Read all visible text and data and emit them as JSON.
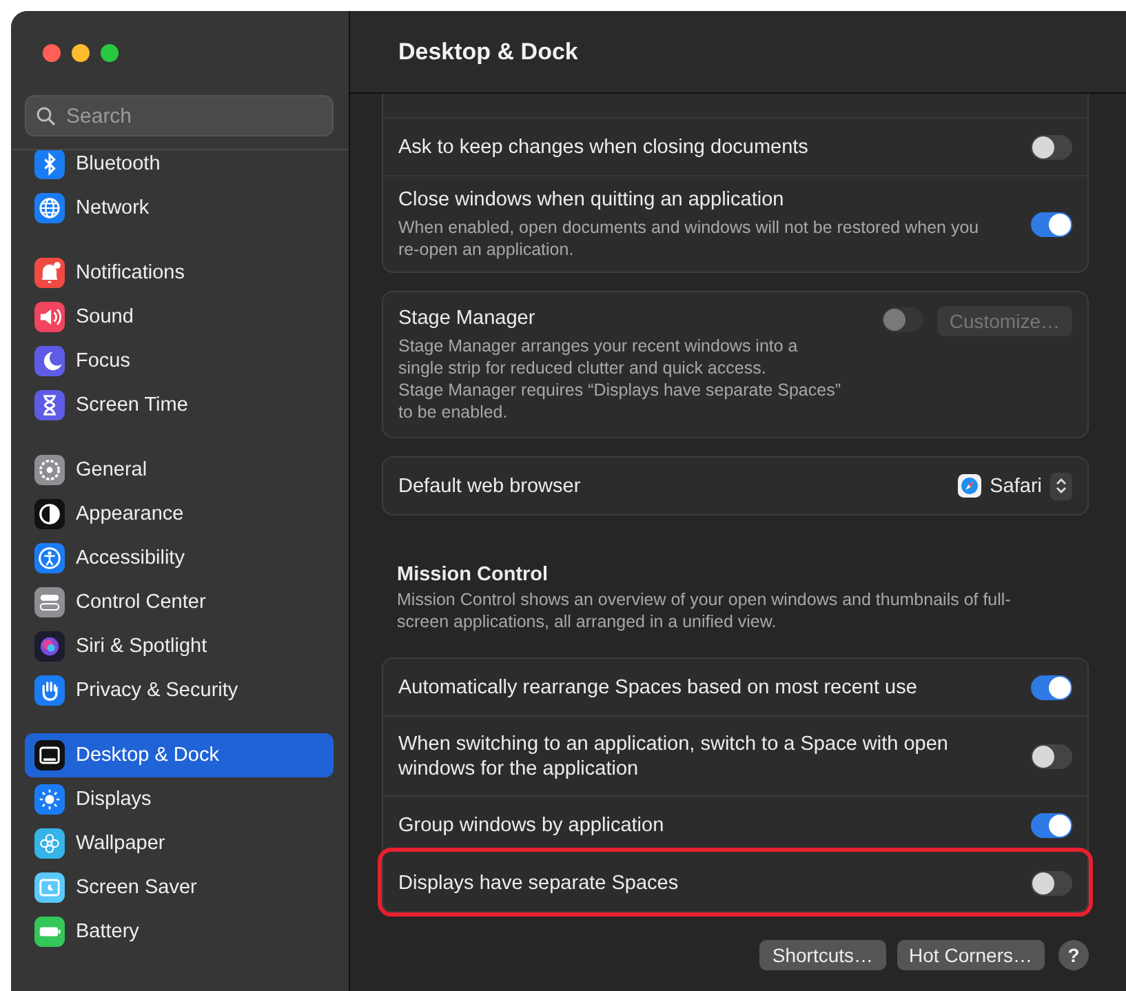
{
  "window": {
    "title": "Desktop & Dock"
  },
  "sidebar": {
    "search": {
      "placeholder": "Search"
    },
    "groups": [
      [
        {
          "label": "Bluetooth",
          "selected": false
        },
        {
          "label": "Network",
          "selected": false
        }
      ],
      [
        {
          "label": "Notifications",
          "selected": false
        },
        {
          "label": "Sound",
          "selected": false
        },
        {
          "label": "Focus",
          "selected": false
        },
        {
          "label": "Screen Time",
          "selected": false
        }
      ],
      [
        {
          "label": "General",
          "selected": false
        },
        {
          "label": "Appearance",
          "selected": false
        },
        {
          "label": "Accessibility",
          "selected": false
        },
        {
          "label": "Control Center",
          "selected": false
        },
        {
          "label": "Siri & Spotlight",
          "selected": false
        },
        {
          "label": "Privacy & Security",
          "selected": false
        }
      ],
      [
        {
          "label": "Desktop & Dock",
          "selected": true
        },
        {
          "label": "Displays",
          "selected": false
        },
        {
          "label": "Wallpaper",
          "selected": false
        },
        {
          "label": "Screen Saver",
          "selected": false
        },
        {
          "label": "Battery",
          "selected": false
        }
      ]
    ]
  },
  "windows_group": {
    "rows": [
      {
        "label": "Ask to keep changes when closing documents",
        "on": false
      },
      {
        "label": "Close windows when quitting an application",
        "description": "When enabled, open documents and windows will not be restored when you\nre-open an application.",
        "on": true
      }
    ]
  },
  "stage_manager": {
    "label": "Stage Manager",
    "description": "Stage Manager arranges your recent windows into a\nsingle strip for reduced clutter and quick access.\nStage Manager requires “Displays have separate Spaces”\nto be enabled.",
    "on": false,
    "disabled": true,
    "customize": {
      "label": "Customize…",
      "disabled": true
    }
  },
  "default_browser": {
    "label": "Default web browser",
    "value": "Safari"
  },
  "mission_control": {
    "title": "Mission Control",
    "description": "Mission Control shows an overview of your open windows and thumbnails of full-\nscreen applications, all arranged in a unified view.",
    "rows": [
      {
        "label": "Automatically rearrange Spaces based on most recent use",
        "on": true,
        "highlighted": false
      },
      {
        "label": "When switching to an application, switch to a Space with open\nwindows for the application",
        "on": false,
        "highlighted": false
      },
      {
        "label": "Group windows by application",
        "on": true,
        "highlighted": false
      },
      {
        "label": "Displays have separate Spaces",
        "on": false,
        "highlighted": true
      }
    ]
  },
  "buttons": [
    {
      "label": "Shortcuts…",
      "kind": "text"
    },
    {
      "label": "Hot Corners…",
      "kind": "text"
    },
    {
      "label": "?",
      "kind": "help"
    }
  ]
}
